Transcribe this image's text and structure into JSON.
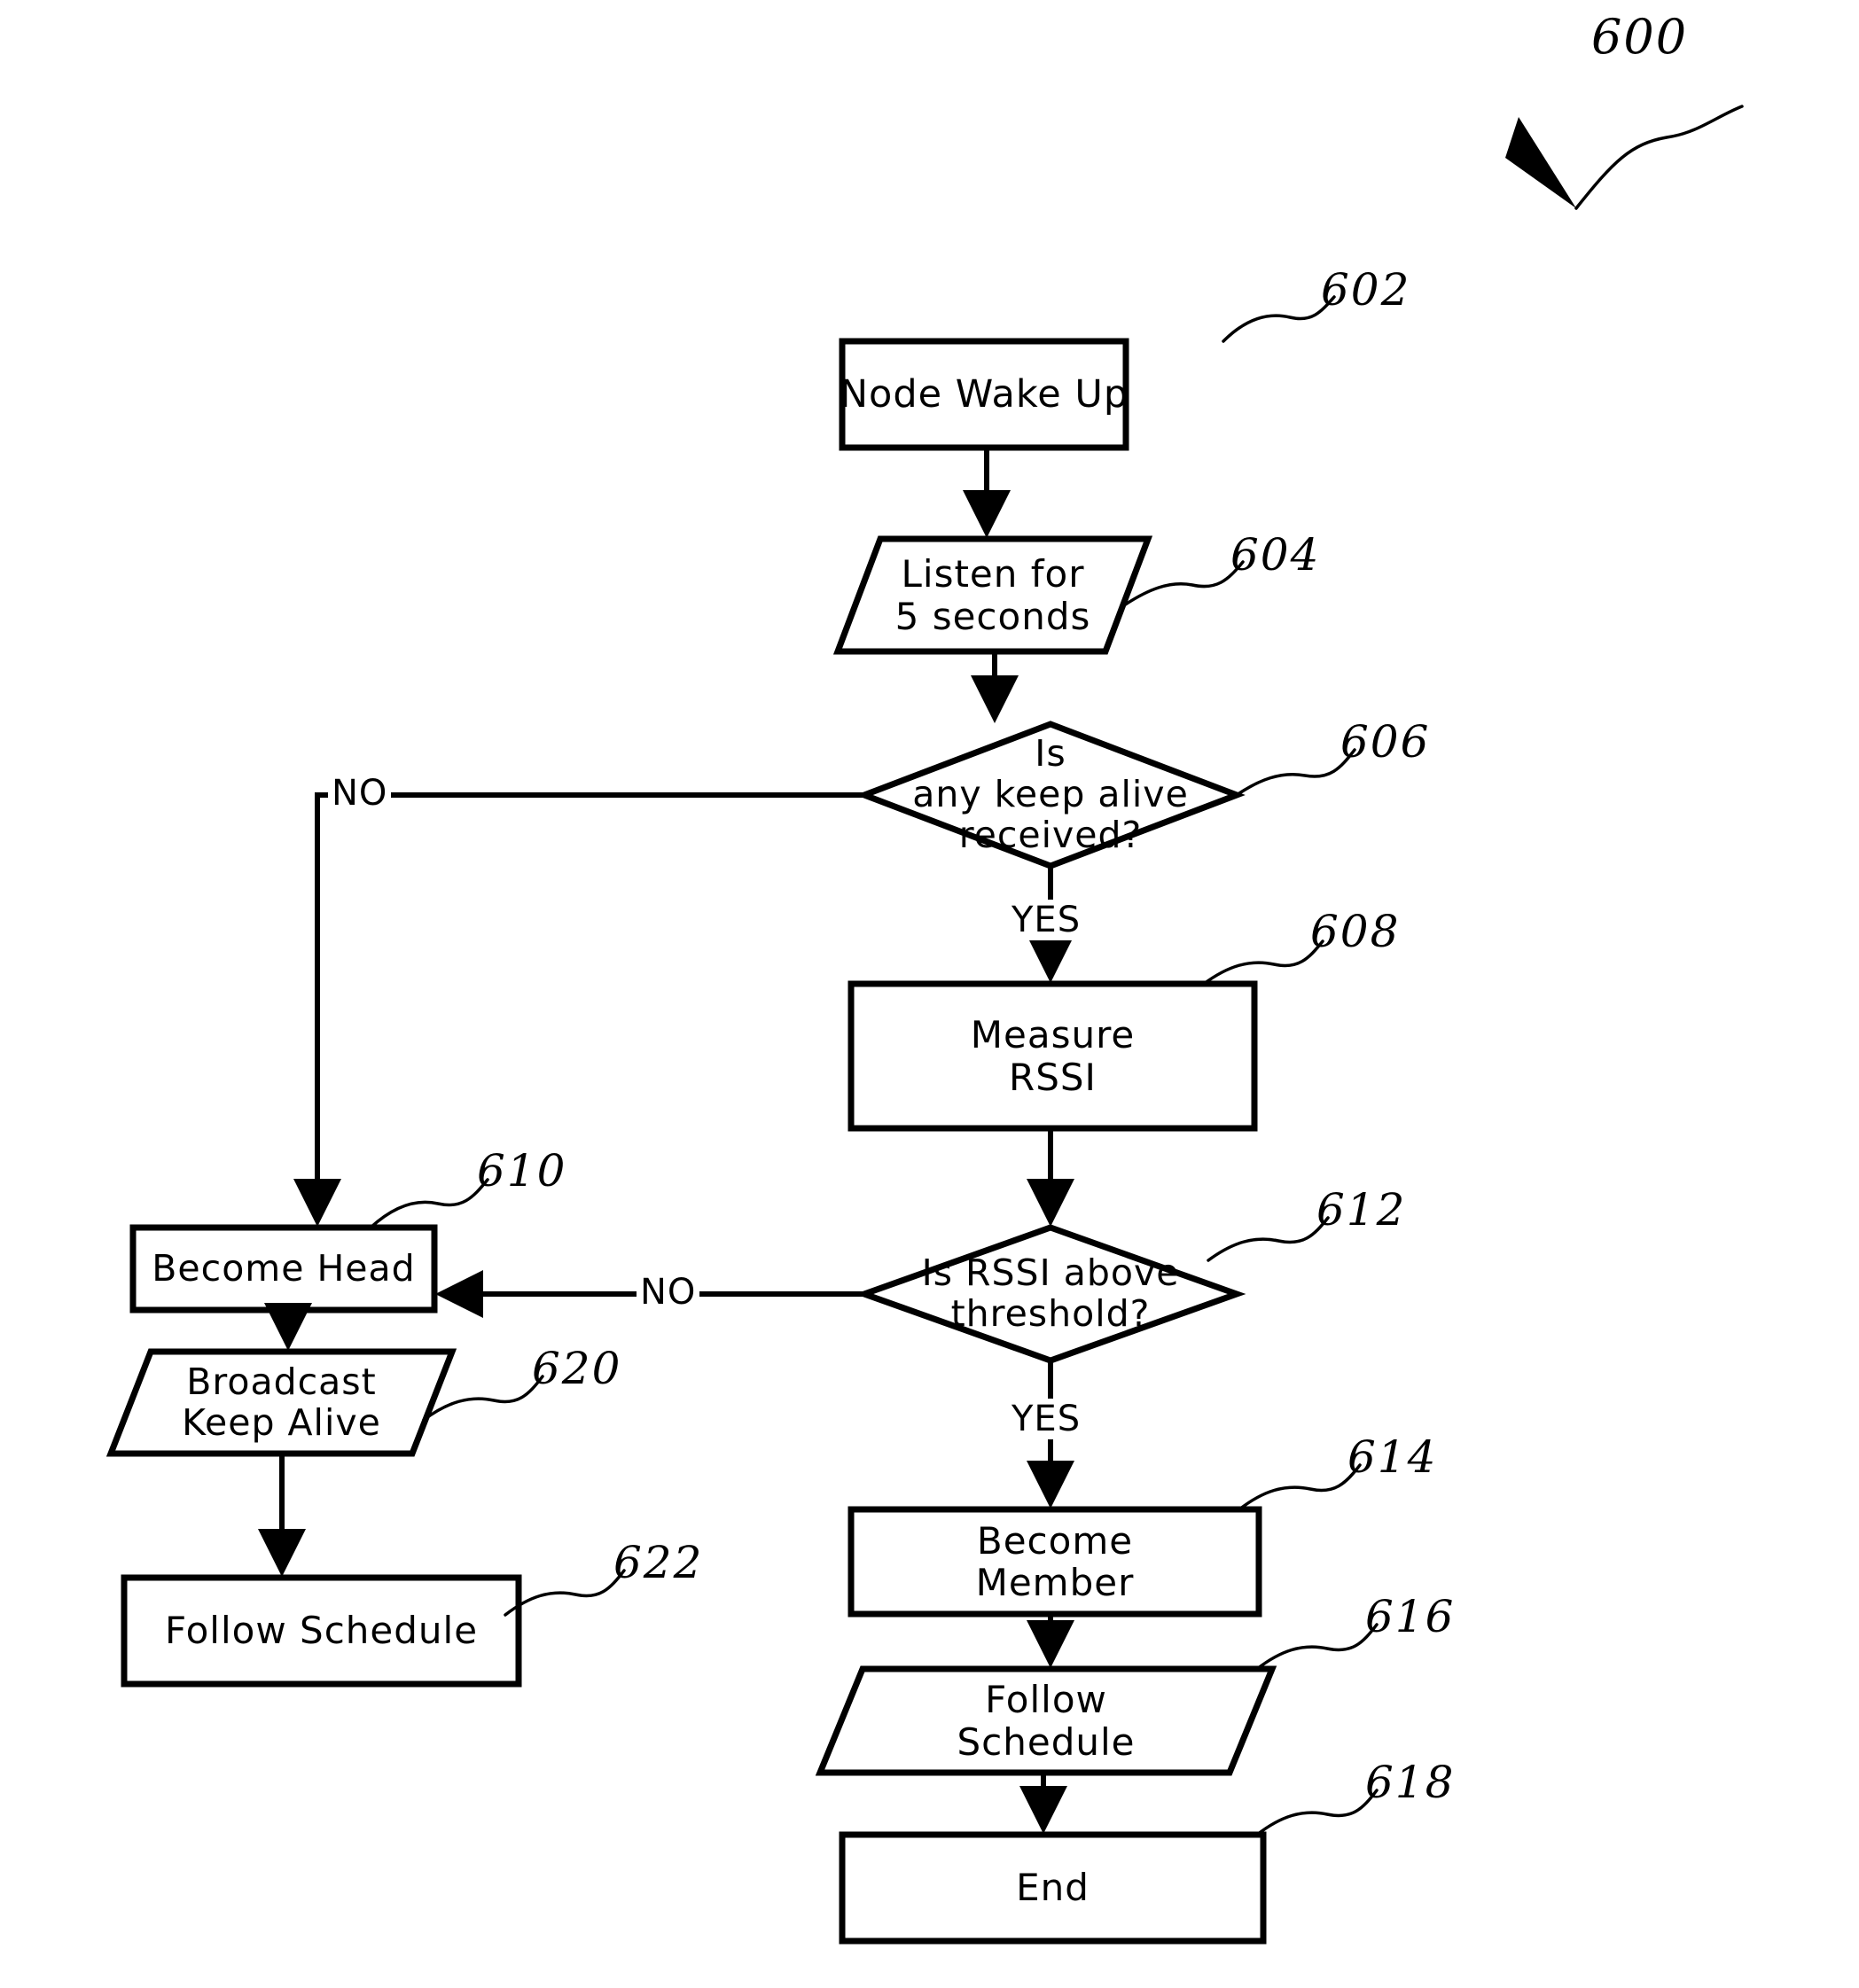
{
  "figure": {
    "number": "600",
    "title": "Node cluster-head election flowchart"
  },
  "nodes": [
    {
      "id": "602",
      "ref": "602",
      "shape": "process",
      "lines": [
        "Node Wake Up"
      ]
    },
    {
      "id": "604",
      "ref": "604",
      "shape": "parallelogram",
      "lines": [
        "Listen  for",
        "5  seconds"
      ]
    },
    {
      "id": "606",
      "ref": "606",
      "shape": "decision",
      "lines": [
        "Is",
        "any  keep  alive",
        "received?"
      ]
    },
    {
      "id": "608",
      "ref": "608",
      "shape": "process",
      "lines": [
        "Measure",
        "RSSI"
      ]
    },
    {
      "id": "610",
      "ref": "610",
      "shape": "process",
      "lines": [
        "Become  Head"
      ]
    },
    {
      "id": "612",
      "ref": "612",
      "shape": "decision",
      "lines": [
        "Is RSSI above",
        "threshold?"
      ]
    },
    {
      "id": "614",
      "ref": "614",
      "shape": "process",
      "lines": [
        "Become",
        "Member"
      ]
    },
    {
      "id": "616",
      "ref": "616",
      "shape": "parallelogram",
      "lines": [
        "Follow",
        "Schedule"
      ]
    },
    {
      "id": "618",
      "ref": "618",
      "shape": "process",
      "lines": [
        "End"
      ]
    },
    {
      "id": "620",
      "ref": "620",
      "shape": "parallelogram",
      "lines": [
        "Broadcast",
        "Keep  Alive"
      ]
    },
    {
      "id": "622",
      "ref": "622",
      "shape": "process",
      "lines": [
        "Follow  Schedule"
      ]
    }
  ],
  "edges": [
    {
      "from": "602",
      "to": "604",
      "label": ""
    },
    {
      "from": "604",
      "to": "606",
      "label": ""
    },
    {
      "from": "606",
      "to": "610",
      "label": "NO"
    },
    {
      "from": "606",
      "to": "608",
      "label": "YES"
    },
    {
      "from": "608",
      "to": "612",
      "label": ""
    },
    {
      "from": "612",
      "to": "610",
      "label": "NO"
    },
    {
      "from": "612",
      "to": "614",
      "label": "YES"
    },
    {
      "from": "614",
      "to": "616",
      "label": ""
    },
    {
      "from": "616",
      "to": "618",
      "label": ""
    },
    {
      "from": "610",
      "to": "620",
      "label": ""
    },
    {
      "from": "620",
      "to": "622",
      "label": ""
    }
  ],
  "edge_labels": {
    "no_from_606": "NO",
    "yes_from_606": "YES",
    "no_from_612": "NO",
    "yes_from_612": "YES"
  },
  "style": {
    "ink": "#000000",
    "paper": "#ffffff"
  }
}
